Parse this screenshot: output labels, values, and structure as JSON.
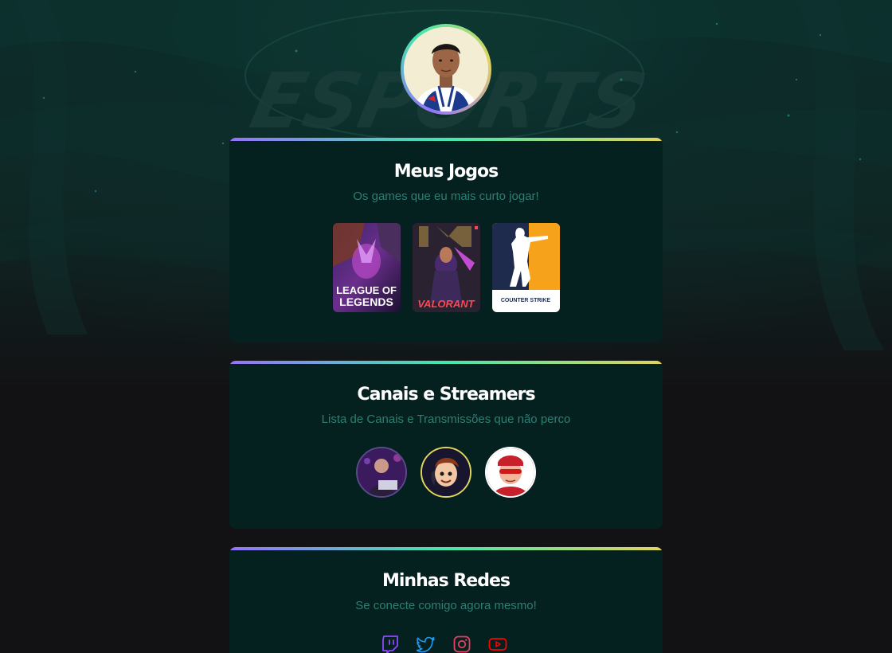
{
  "profile": {
    "avatar_icon": "profile-photo"
  },
  "background": {
    "watermark_text": "ESPORTS"
  },
  "games_card": {
    "title": "Meus Jogos",
    "subtitle": "Os games que eu mais curto jogar!",
    "games": [
      {
        "name": "League of Legends",
        "line1": "LEAGUE OF",
        "line2": "LEGENDS"
      },
      {
        "name": "Valorant",
        "label": "VALORANT"
      },
      {
        "name": "Counter Strike",
        "label": "COUNTER STRIKE"
      }
    ]
  },
  "streamers_card": {
    "title": "Canais e Streamers",
    "subtitle": "Lista de Canais e Transmissões que não perco",
    "streamers": [
      {
        "icon": "streamer-avatar-1"
      },
      {
        "icon": "streamer-avatar-2"
      },
      {
        "icon": "streamer-avatar-3"
      }
    ]
  },
  "socials_card": {
    "title": "Minhas Redes",
    "subtitle": "Se conecte comigo agora mesmo!",
    "icons": [
      "twitch-icon",
      "twitter-icon",
      "instagram-icon",
      "youtube-icon"
    ],
    "colors": {
      "twitch": "#9147ff",
      "twitter": "#1d9bf0",
      "instagram": "#e4405f",
      "youtube": "#ff0000"
    }
  },
  "theme": {
    "accent_gradient": [
      "#9572fc",
      "#43e7ad",
      "#e2d45c"
    ],
    "card_bg": "#04201f",
    "subtitle_color": "#2e7f73"
  }
}
